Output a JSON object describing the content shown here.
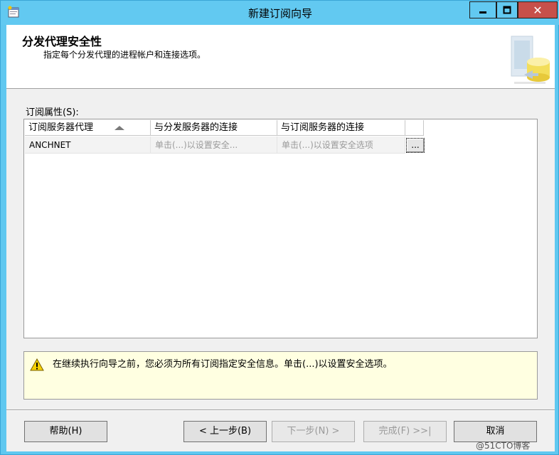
{
  "window": {
    "title": "新建订阅向导",
    "min_label": "—",
    "max_label": "□",
    "close_label": "✕"
  },
  "header": {
    "title": "分发代理安全性",
    "subtitle": "指定每个分发代理的进程帐户和连接选项。"
  },
  "grid": {
    "label": "订阅属性(S):",
    "columns": [
      "订阅服务器代理",
      "与分发服务器的连接",
      "与订阅服务器的连接",
      ""
    ],
    "rows": [
      {
        "agent": "ANCHNET",
        "distributor_conn": "单击(...)以设置安全...",
        "subscriber_conn": "单击(...)以设置安全选项",
        "button": "..."
      }
    ]
  },
  "warning": {
    "text": "在继续执行向导之前，您必须为所有订阅指定安全信息。单击(...)以设置安全选项。"
  },
  "buttons": {
    "help": "帮助(H)",
    "back": "< 上一步(B)",
    "next": "下一步(N) >",
    "finish": "完成(F) >>|",
    "cancel": "取消"
  },
  "watermark": "@51CTO博客"
}
